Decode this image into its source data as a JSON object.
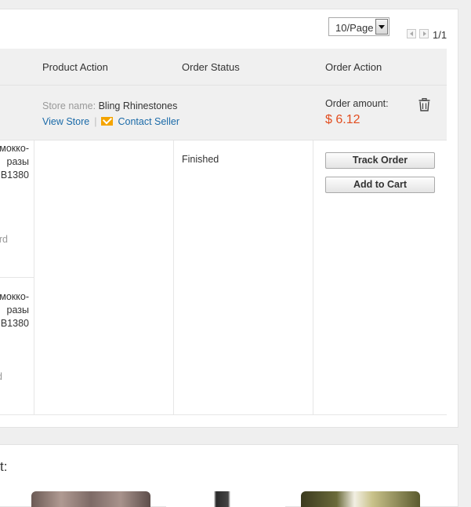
{
  "pager": {
    "per_page": "10/Page",
    "page_count": "1/1"
  },
  "columns": {
    "product_action": "Product Action",
    "order_status": "Order Status",
    "order_action": "Order Action"
  },
  "store": {
    "name_label": "Store name:",
    "name": "Bling Rhinestones",
    "view_store": "View Store",
    "separator": "|",
    "contact_seller": "Contact Seller"
  },
  "order": {
    "amount_label": "Order amount:",
    "amount": "$ 6.12",
    "status": "Finished",
    "track_label": "Track Order",
    "cart_label": "Add to Cart"
  },
  "items": [
    {
      "line1": "мокко-",
      "line2": "разы",
      "line3": "B1380",
      "tail": "rd"
    },
    {
      "line1": "мокко-",
      "line2": "разы",
      "line3": "B1380",
      "tail": "d"
    }
  ],
  "recommend": {
    "title": "t:"
  },
  "colors": {
    "price": "#e24d1f",
    "link": "#1a6aa8",
    "mail": "#f4a400"
  }
}
